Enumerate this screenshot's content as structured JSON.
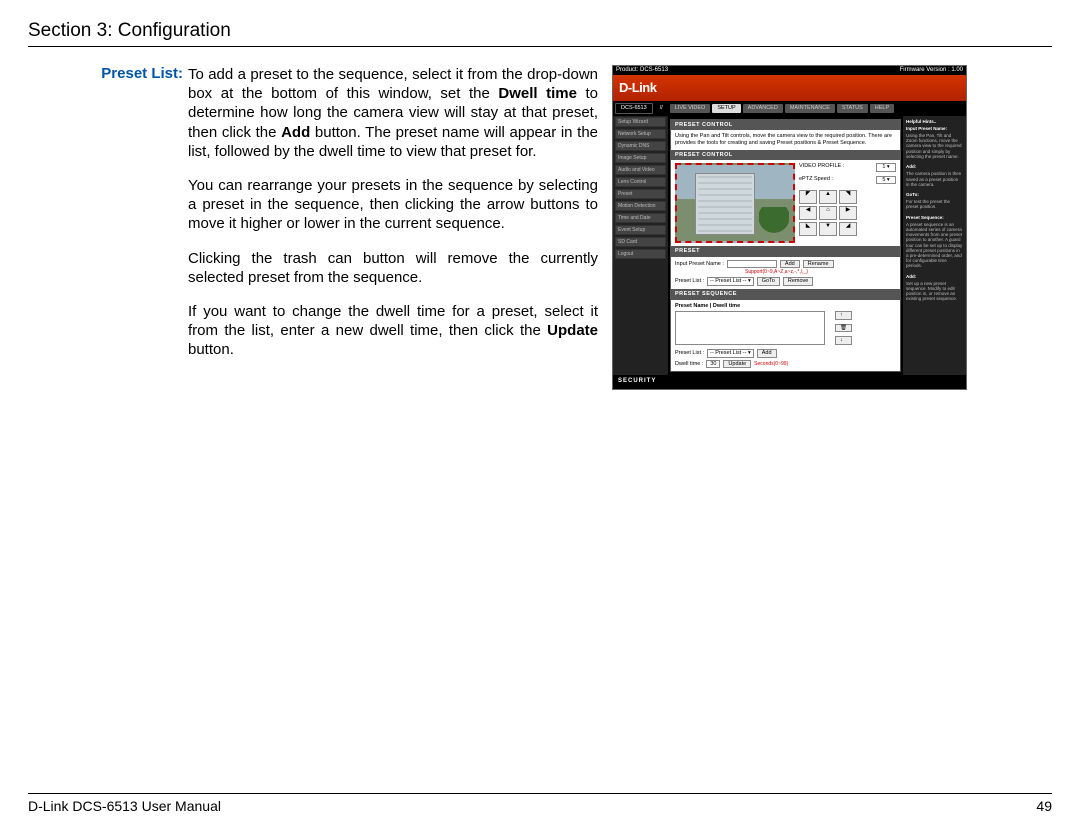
{
  "section_title": "Section 3: Configuration",
  "label": "Preset List:",
  "paragraphs": {
    "p1a": "To add a preset to the sequence, select it from the drop-down box at the bottom of this window, set the ",
    "p1b": "Dwell time",
    "p1c": " to determine how long the camera view will stay at that preset, then click the ",
    "p1d": "Add",
    "p1e": " button. The preset name will appear in the list, followed by the dwell time to view that preset for.",
    "p2": "You can rearrange your presets in the sequence by selecting a preset in the sequence, then clicking the arrow buttons to move it higher or lower in the current sequence.",
    "p3": "Clicking the trash can button will remove the currently selected preset from the sequence.",
    "p4a": "If you want to change the dwell time for a preset, select it from the list, enter a new dwell time, then click the ",
    "p4b": "Update",
    "p4c": " button."
  },
  "shot": {
    "product": "Product: DCS-6513",
    "firmware": "Firmware Version : 1.00",
    "brand": "D-Link",
    "model_tab": "DCS-6513",
    "tabs": [
      "LIVE VIDEO",
      "SETUP",
      "ADVANCED",
      "MAINTENANCE",
      "STATUS",
      "HELP"
    ],
    "sidebar": [
      "Setup Wizard",
      "Network Setup",
      "Dynamic DNS",
      "Image Setup",
      "Audio and Video",
      "Lens Control",
      "Preset",
      "Motion Detection",
      "Time and Date",
      "Event Setup",
      "SD Card",
      "Logout"
    ],
    "panel_preset_intro_head": "PRESET CONTROL",
    "panel_preset_intro_text": "Using the Pan and Tilt controls, move the camera view to the required position. There are provides the tools for creating and saving Preset positions & Preset Sequence.",
    "panel_preset_control_head": "PRESET CONTROL",
    "video_profile_label": "VIDEO PROFILE :",
    "video_profile_val": "1",
    "eptz_label": "ePTZ Speed :",
    "eptz_val": "5",
    "arrows": {
      "up": "▲",
      "down": "▼",
      "left": "◀",
      "right": "▶",
      "home": "⌂",
      "ul": "◤",
      "ur": "◥",
      "dl": "◣",
      "dr": "◢"
    },
    "panel_preset_head": "PRESET",
    "input_preset_label": "Input Preset Name :",
    "btn_add": "Add",
    "btn_rename": "Rename",
    "support_text": "Support(0~9,A~Z,a~z,-,*,/,_)",
    "preset_list_label": "Preset List :",
    "preset_list_val": "-- Preset List --",
    "btn_goto": "GoTo",
    "btn_remove": "Remove",
    "panel_seq_head": "PRESET SEQUENCE",
    "seq_cols": "Preset Name | Dwell time",
    "up_icon": "↑",
    "trash_icon": "🗑",
    "down_icon": "↓",
    "seq_preset_label": "Preset List :",
    "seq_preset_val": "-- Preset List --",
    "btn_add2": "Add",
    "dwell_label": "Dwell time :",
    "dwell_val": "30",
    "btn_update": "Update",
    "seconds_text": "Seconds(0~99)",
    "footer": "SECURITY",
    "help_head": "Helpful Hints..",
    "help_text1_h": "Input Preset Name:",
    "help_text1": "Using the Pan, Tilt and Zoom functions, move the camera view to the required position and simply by selecting the preset name.",
    "help_text2_h": "Add:",
    "help_text2": "The camera position is then saved as a preset position in the camera.",
    "help_text3_h": "GoTo:",
    "help_text3": "For test the preset the preset position.",
    "help_text4_h": "Preset Sequence:",
    "help_text4": "A preset sequence is an automated series of camera movements from one preset position to another. A guard tour can be set up to display different preset positions in a pre-determined order, and for configurable time periods.",
    "help_text5_h": "Add:",
    "help_text5": "Set up a new preset sequence. Modify to edit position in, or remove an existing preset sequence."
  },
  "footer_left": "D-Link DCS-6513 User Manual",
  "footer_right": "49"
}
